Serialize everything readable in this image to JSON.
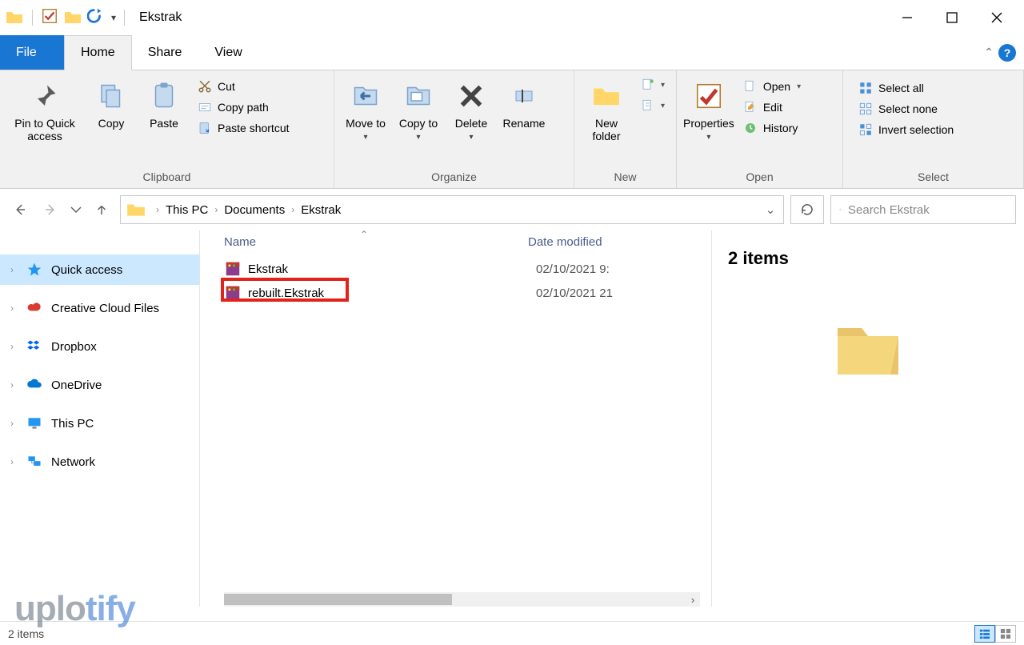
{
  "window": {
    "title": "Ekstrak"
  },
  "tabs": {
    "file": "File",
    "home": "Home",
    "share": "Share",
    "view": "View"
  },
  "ribbon": {
    "clipboard": {
      "label": "Clipboard",
      "pin": "Pin to Quick access",
      "copy": "Copy",
      "paste": "Paste",
      "cut": "Cut",
      "copy_path": "Copy path",
      "paste_shortcut": "Paste shortcut"
    },
    "organize": {
      "label": "Organize",
      "move_to": "Move to",
      "copy_to": "Copy to",
      "delete": "Delete",
      "rename": "Rename"
    },
    "new": {
      "label": "New",
      "new_folder": "New folder",
      "new_item": "New item",
      "easy_access": "Easy access"
    },
    "open": {
      "label": "Open",
      "properties": "Properties",
      "open": "Open",
      "edit": "Edit",
      "history": "History"
    },
    "select": {
      "label": "Select",
      "select_all": "Select all",
      "select_none": "Select none",
      "invert": "Invert selection"
    }
  },
  "breadcrumb": {
    "items": [
      "This PC",
      "Documents",
      "Ekstrak"
    ]
  },
  "search": {
    "placeholder": "Search Ekstrak"
  },
  "sidebar": {
    "items": [
      {
        "label": "Quick access",
        "id": "quick-access"
      },
      {
        "label": "Creative Cloud Files",
        "id": "creative-cloud"
      },
      {
        "label": "Dropbox",
        "id": "dropbox"
      },
      {
        "label": "OneDrive",
        "id": "onedrive"
      },
      {
        "label": "This PC",
        "id": "this-pc"
      },
      {
        "label": "Network",
        "id": "network"
      }
    ]
  },
  "columns": {
    "name": "Name",
    "date": "Date modified"
  },
  "files": [
    {
      "name": "Ekstrak",
      "date": "02/10/2021 9:"
    },
    {
      "name": "rebuilt.Ekstrak",
      "date": "02/10/2021 21"
    }
  ],
  "preview": {
    "title": "2 items"
  },
  "status": {
    "text": "2 items"
  },
  "watermark": {
    "a": "uplo",
    "b": "tify"
  }
}
